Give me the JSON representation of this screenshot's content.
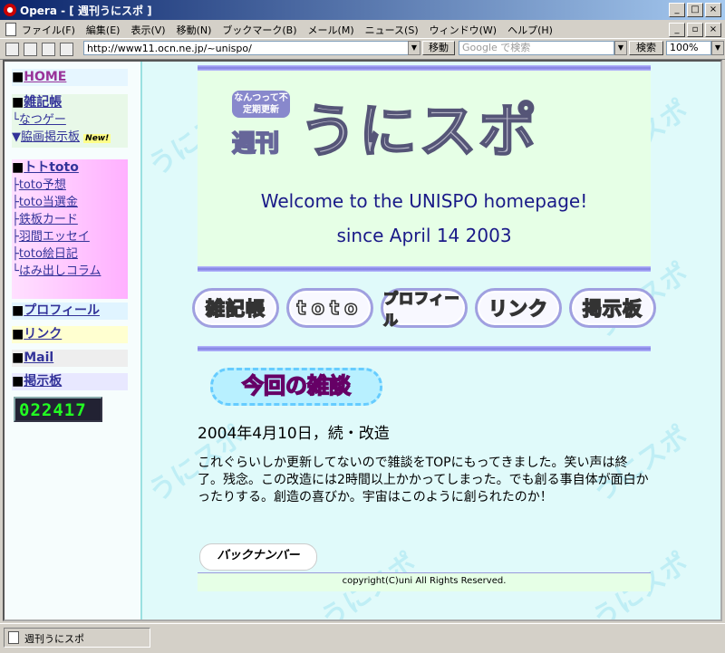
{
  "window": {
    "title": "Opera - [ 週刊うにスポ ]"
  },
  "menu": [
    "ファイル(F)",
    "編集(E)",
    "表示(V)",
    "移動(N)",
    "ブックマーク(B)",
    "メール(M)",
    "ニュース(S)",
    "ウィンドウ(W)",
    "ヘルプ(H)"
  ],
  "toolbar": {
    "url": "http://www11.ocn.ne.jp/~unispo/",
    "go_label": "移動",
    "search_placeholder": "Google で検索",
    "search_label": "検索",
    "zoom": "100%"
  },
  "sidebar": {
    "home": "HOME",
    "zakki": "雑記帳",
    "zakki_sub": "なつゲー",
    "bbs_movie": "脇画掲示板",
    "new_badge": "New!",
    "toto": "トトtoto",
    "toto_links": [
      "toto予想",
      "toto当選金",
      "鉄板カード",
      "羽間エッセイ",
      "toto絵日記",
      "はみ出しコラム"
    ],
    "profile": "プロフィール",
    "link": "リンク",
    "mail": "Mail",
    "bbs": "掲示板",
    "counter": "022417"
  },
  "banner": {
    "tag": "なんつって不定期更新",
    "sub": "週刊",
    "title": "うにスポ",
    "welcome": "Welcome to the UNISPO homepage!",
    "since": "since April 14 2003"
  },
  "nav_buttons": [
    "雑記帳",
    "toto",
    "プロフィール",
    "リンク",
    "掲示板"
  ],
  "talk": {
    "heading": "今回の雑談",
    "date": "2004年4月10日，続・改造",
    "body": "これぐらいしか更新してないので雑談をTOPにもってきました。笑い声は終了。残念。この改造には2時間以上かかってしまった。でも創る事自体が面白かったりする。創造の喜びか。宇宙はこのように創られたのか！",
    "back_number": "バックナンバー"
  },
  "footer": "copyright(C)uni All Rights Reserved.",
  "status": "週刊うにスポ",
  "watermark": "うにスポ"
}
